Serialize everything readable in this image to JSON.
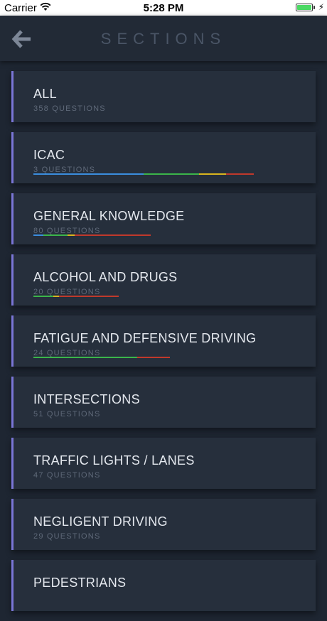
{
  "status_bar": {
    "carrier": "Carrier",
    "time": "5:28 PM",
    "charging_symbol": "⚡"
  },
  "header": {
    "title": "SECTIONS",
    "back_icon": "arrow-left-icon"
  },
  "colors": {
    "accent": "#7a76d6",
    "background": "#1e2632",
    "card": "#262f3c",
    "progress_blue": "#3a8dde",
    "progress_green": "#3bb54a",
    "progress_yellow": "#d9b51e",
    "progress_red": "#c0392b"
  },
  "sections": [
    {
      "name": "ALL",
      "count": "358 QUESTIONS"
    },
    {
      "name": "ICAC",
      "count": "3 QUESTIONS"
    },
    {
      "name": "GENERAL KNOWLEDGE",
      "count": "80 QUESTIONS"
    },
    {
      "name": "ALCOHOL AND DRUGS",
      "count": "20 QUESTIONS"
    },
    {
      "name": "FATIGUE AND DEFENSIVE DRIVING",
      "count": "24 QUESTIONS"
    },
    {
      "name": "INTERSECTIONS",
      "count": "51 QUESTIONS"
    },
    {
      "name": "TRAFFIC LIGHTS / LANES",
      "count": "47 QUESTIONS"
    },
    {
      "name": "NEGLIGENT DRIVING",
      "count": "29 QUESTIONS"
    },
    {
      "name": "PEDESTRIANS",
      "count": ""
    }
  ]
}
